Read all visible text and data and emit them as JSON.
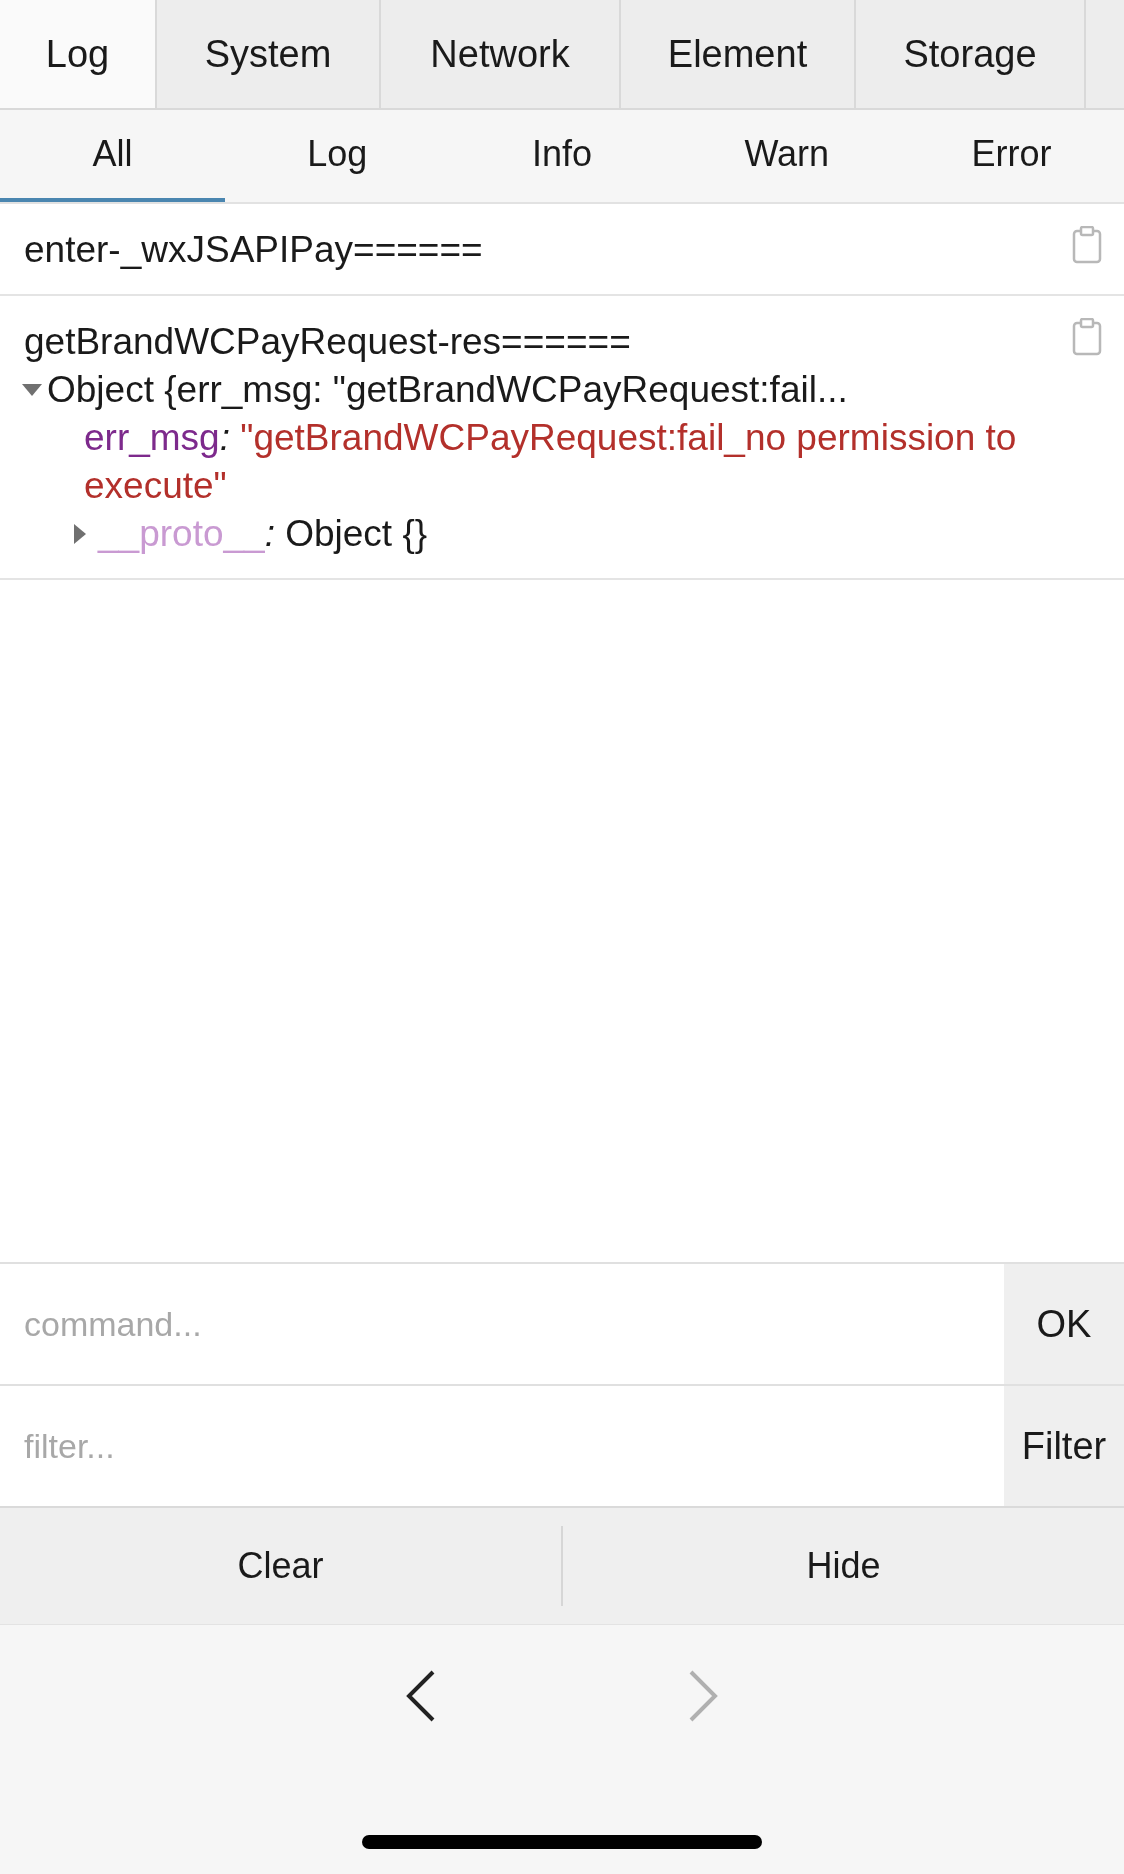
{
  "main_tabs": [
    {
      "label": "Log",
      "selected": true
    },
    {
      "label": "System",
      "selected": false
    },
    {
      "label": "Network",
      "selected": false
    },
    {
      "label": "Element",
      "selected": false
    },
    {
      "label": "Storage",
      "selected": false
    }
  ],
  "sub_tabs": [
    {
      "label": "All",
      "selected": true
    },
    {
      "label": "Log",
      "selected": false
    },
    {
      "label": "Info",
      "selected": false
    },
    {
      "label": "Warn",
      "selected": false
    },
    {
      "label": "Error",
      "selected": false
    }
  ],
  "logs": [
    {
      "kind": "text",
      "text": "enter-_wxJSAPIPay======"
    },
    {
      "kind": "object",
      "text": "getBrandWCPayRequest-res======",
      "object": {
        "summary": "Object {err_msg: \"getBrandWCPayRequest:fail...",
        "expanded": true,
        "properties": [
          {
            "key": "err_msg",
            "sep": ":",
            "value": "\"getBrandWCPayRequest:fail_no permission to execute\""
          }
        ],
        "proto": {
          "key": "__proto__",
          "sep": ":",
          "value": "Object {}",
          "expanded": false
        }
      }
    }
  ],
  "command": {
    "placeholder": "command...",
    "button": "OK"
  },
  "filter": {
    "placeholder": "filter...",
    "button": "Filter"
  },
  "actions": [
    "Clear",
    "Hide"
  ],
  "browser_nav": {
    "back_disabled": false,
    "forward_disabled": true
  }
}
